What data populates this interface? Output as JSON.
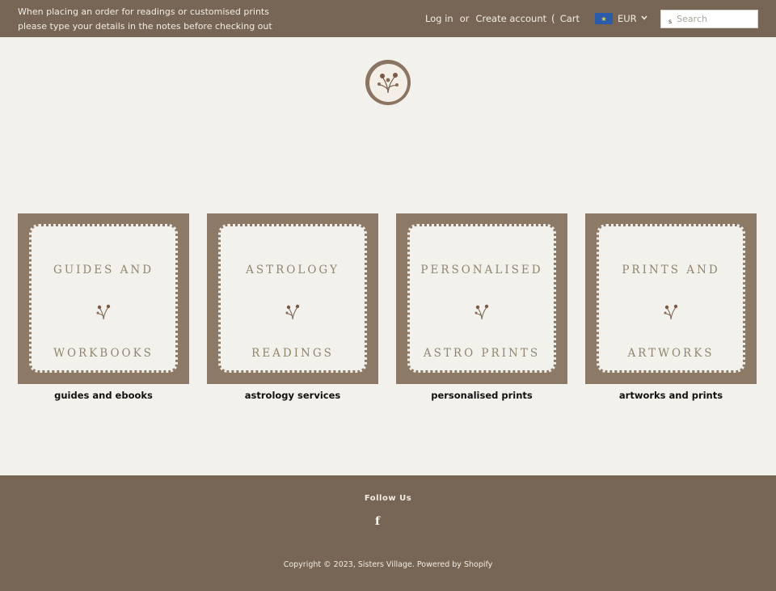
{
  "announcement": {
    "line1": "When placing an order for readings or customised prints",
    "line2": "please type your details in the notes before checking out"
  },
  "header": {
    "login_label": "Log in",
    "or_label": "or",
    "create_account_label": "Create account",
    "cart_label": "Cart",
    "currency": "EUR",
    "search_placeholder": "Search"
  },
  "collections": [
    {
      "title_line1": "GUIDES AND",
      "title_line2": "WORKBOOKS",
      "caption": "guides and ebooks"
    },
    {
      "title_line1": "ASTROLOGY",
      "title_line2": "READINGS",
      "caption": "astrology services"
    },
    {
      "title_line1": "PERSONALISED",
      "title_line2": "ASTRO PRINTS",
      "caption": "personalised prints"
    },
    {
      "title_line1": "PRINTS AND",
      "title_line2": "ARTWORKS",
      "caption": "artworks and prints"
    }
  ],
  "footer": {
    "follow_label": "Follow Us",
    "facebook_glyph": "f",
    "copyright": "Copyright © 2023, Sisters Village. Powered by Shopify"
  },
  "colors": {
    "topbar": "#776655",
    "card_frame": "#8c7a66",
    "background": "#f3f1ec",
    "card_text": "#8f866d"
  }
}
